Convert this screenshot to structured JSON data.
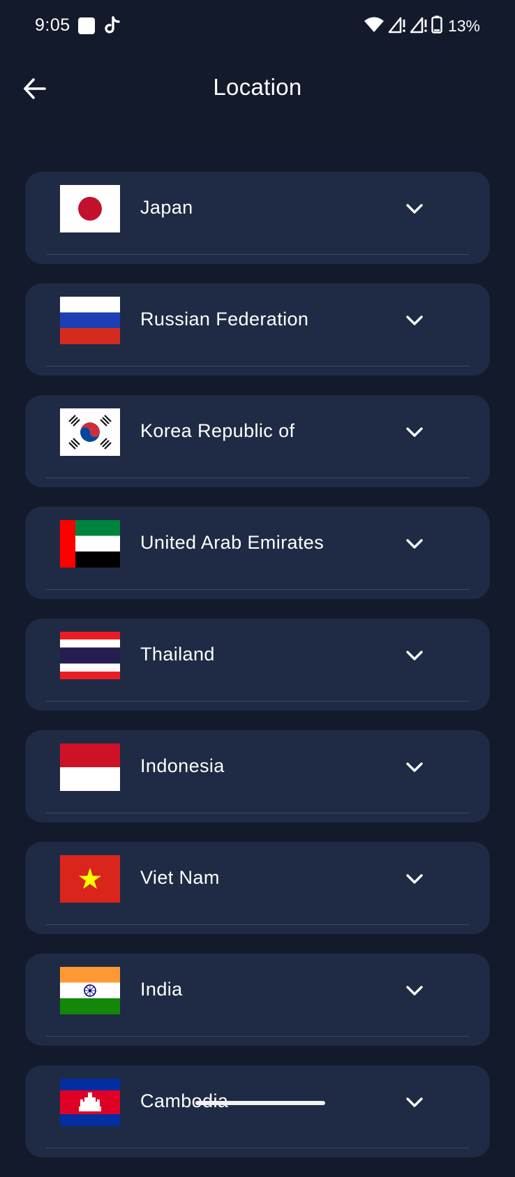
{
  "status_bar": {
    "time": "9:05",
    "icons": [
      "square-notification-icon",
      "tiktok-icon",
      "wifi-icon",
      "signal-icon",
      "signal-icon",
      "battery-icon"
    ],
    "battery": "13%"
  },
  "header": {
    "title": "Location",
    "back_icon": "arrow-left-icon"
  },
  "countries": [
    {
      "name": "Japan",
      "flag": "flag-japan-icon"
    },
    {
      "name": "Russian Federation",
      "flag": "flag-russia-icon"
    },
    {
      "name": "Korea Republic of",
      "flag": "flag-south-korea-icon"
    },
    {
      "name": "United Arab Emirates",
      "flag": "flag-uae-icon"
    },
    {
      "name": "Thailand",
      "flag": "flag-thailand-icon"
    },
    {
      "name": "Indonesia",
      "flag": "flag-indonesia-icon"
    },
    {
      "name": "Viet Nam",
      "flag": "flag-vietnam-icon"
    },
    {
      "name": "India",
      "flag": "flag-india-icon"
    },
    {
      "name": "Cambodia",
      "flag": "flag-cambodia-icon"
    }
  ],
  "colors": {
    "background": "#131a2b",
    "card": "#1f2b45",
    "divider": "#3e4960",
    "text": "#ffffff"
  }
}
